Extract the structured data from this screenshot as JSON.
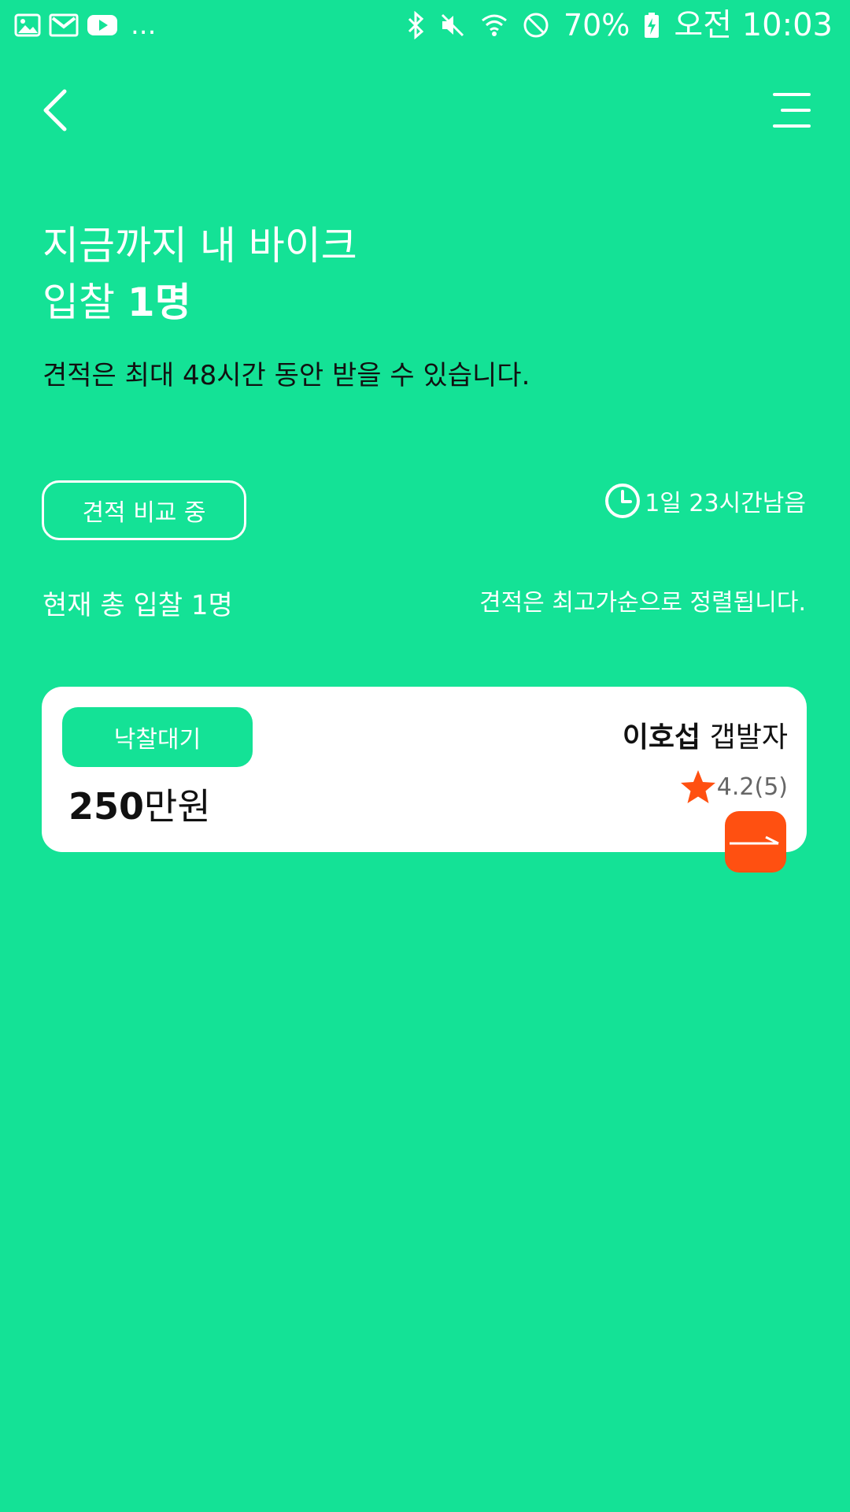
{
  "status_bar": {
    "notifications": [
      "image-icon",
      "gmail-icon",
      "youtube-icon"
    ],
    "more": "...",
    "battery": "70%",
    "time": "오전 10:03"
  },
  "header": {
    "back_icon": "chevron-left-icon",
    "menu_icon": "menu-icon"
  },
  "title": {
    "line1": "지금까지 내 바이크",
    "line2_prefix": "입찰 ",
    "line2_count": "1명"
  },
  "subtitle": "견적은 최대 48시간 동안 받을 수 있습니다.",
  "status_pill": "견적 비교 중",
  "timer": "1일 23시간남음",
  "total_bids": "현재 총 입찰 1명",
  "sort_note": "견적은 최고가순으로 정렬됩니다.",
  "bids": [
    {
      "status": "낙찰대기",
      "price_number": "250",
      "price_unit": "만원",
      "bidder_surname": "이호섭",
      "bidder_role": " 갭발자",
      "rating": "4.2(5)"
    }
  ],
  "colors": {
    "background": "#14E296",
    "accent": "#FF5011",
    "star": "#FF5011"
  }
}
